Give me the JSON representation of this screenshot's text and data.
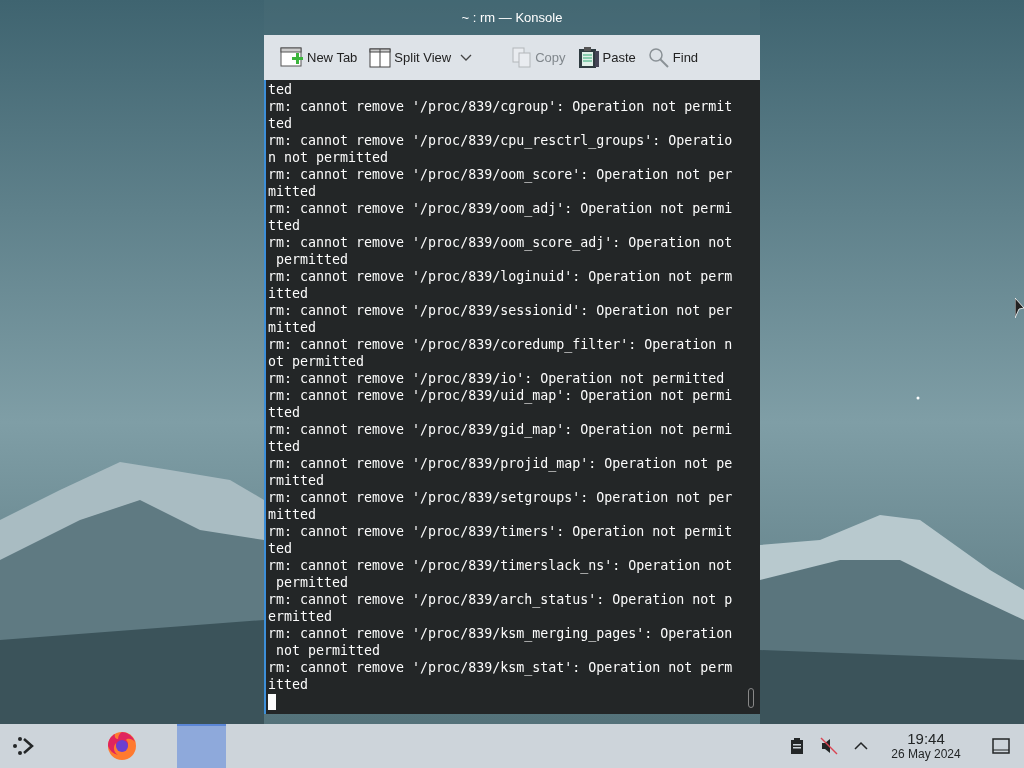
{
  "window": {
    "title": "~ : rm — Konsole"
  },
  "toolbar": [
    {
      "kind": "new-tab",
      "label": "New Tab",
      "disabled": false
    },
    {
      "kind": "split-view",
      "label": "Split View",
      "disabled": false
    },
    {
      "kind": "copy",
      "label": "Copy",
      "disabled": true
    },
    {
      "kind": "paste",
      "label": "Paste",
      "disabled": false
    },
    {
      "kind": "find",
      "label": "Find",
      "disabled": false
    }
  ],
  "terminal": {
    "lines": [
      "ted",
      "rm: cannot remove '/proc/839/cgroup': Operation not permit",
      "ted",
      "rm: cannot remove '/proc/839/cpu_resctrl_groups': Operatio",
      "n not permitted",
      "rm: cannot remove '/proc/839/oom_score': Operation not per",
      "mitted",
      "rm: cannot remove '/proc/839/oom_adj': Operation not permi",
      "tted",
      "rm: cannot remove '/proc/839/oom_score_adj': Operation not",
      " permitted",
      "rm: cannot remove '/proc/839/loginuid': Operation not perm",
      "itted",
      "rm: cannot remove '/proc/839/sessionid': Operation not per",
      "mitted",
      "rm: cannot remove '/proc/839/coredump_filter': Operation n",
      "ot permitted",
      "rm: cannot remove '/proc/839/io': Operation not permitted",
      "rm: cannot remove '/proc/839/uid_map': Operation not permi",
      "tted",
      "rm: cannot remove '/proc/839/gid_map': Operation not permi",
      "tted",
      "rm: cannot remove '/proc/839/projid_map': Operation not pe",
      "rmitted",
      "rm: cannot remove '/proc/839/setgroups': Operation not per",
      "mitted",
      "rm: cannot remove '/proc/839/timers': Operation not permit",
      "ted",
      "rm: cannot remove '/proc/839/timerslack_ns': Operation not",
      " permitted",
      "rm: cannot remove '/proc/839/arch_status': Operation not p",
      "ermitted",
      "rm: cannot remove '/proc/839/ksm_merging_pages': Operation",
      " not permitted",
      "rm: cannot remove '/proc/839/ksm_stat': Operation not perm",
      "itted"
    ]
  },
  "taskbar": {
    "tasks": [
      {
        "kind": "firefox",
        "selected": false
      },
      {
        "kind": "window",
        "selected": true
      }
    ],
    "clock": {
      "time": "19:44",
      "date": "26 May 2024"
    }
  }
}
